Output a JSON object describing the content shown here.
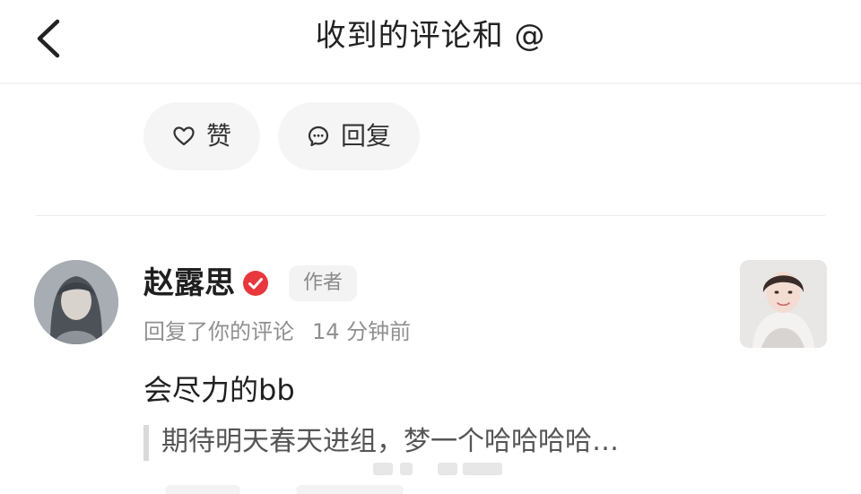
{
  "header": {
    "title": "收到的评论和 @",
    "back_icon": "chevron-left-icon"
  },
  "actions": {
    "like_label": "赞",
    "like_icon": "heart-outline-icon",
    "reply_label": "回复",
    "reply_icon": "chat-bubble-icon"
  },
  "comment": {
    "user_name": "赵露思",
    "verified_icon": "verified-check-icon",
    "verified_color": "#e8383d",
    "author_badge": "作者",
    "action_text": "回复了你的评论",
    "time": "14 分钟前",
    "reply_text": "会尽力的bb",
    "quoted_text": "期待明天春天进组，梦一个哈哈哈哈…"
  },
  "colors": {
    "primary_text": "#1f1f1f",
    "secondary_text": "#8f8f8f",
    "button_bg": "#f5f5f5",
    "accent": "#e8383d"
  }
}
